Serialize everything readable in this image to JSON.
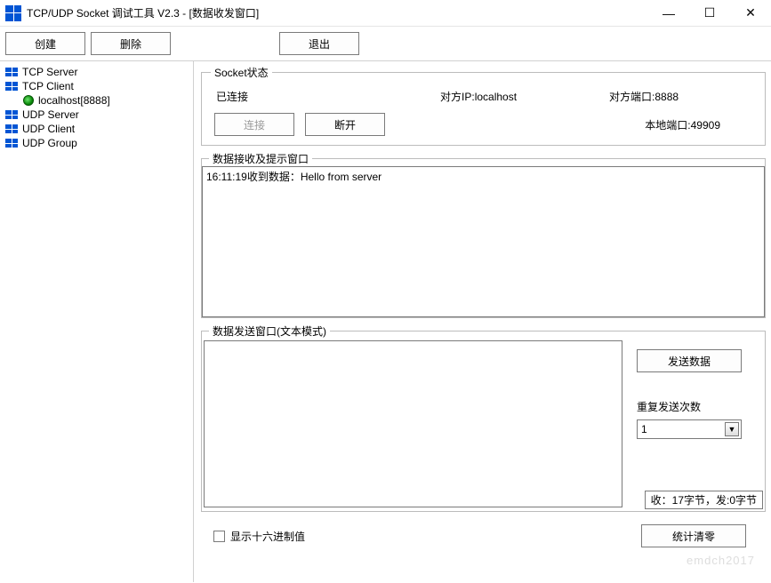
{
  "title": "TCP/UDP Socket 调试工具 V2.3 - [数据收发窗口]",
  "toolbar": {
    "create": "创建",
    "delete": "删除",
    "exit": "退出"
  },
  "tree": {
    "items": [
      {
        "label": "TCP Server",
        "type": "node"
      },
      {
        "label": "TCP Client",
        "type": "node"
      },
      {
        "label": "localhost[8888]",
        "type": "conn"
      },
      {
        "label": "UDP Server",
        "type": "node"
      },
      {
        "label": "UDP Client",
        "type": "node"
      },
      {
        "label": "UDP Group",
        "type": "node"
      }
    ]
  },
  "status": {
    "legend": "Socket状态",
    "state": "已连接",
    "peer_ip_label": "对方IP:",
    "peer_ip": "localhost",
    "peer_port_label": "对方端口:",
    "peer_port": "8888",
    "connect": "连接",
    "disconnect": "断开",
    "local_port_label": "本地端口:",
    "local_port": "49909"
  },
  "rx": {
    "legend": "数据接收及提示窗口",
    "line": "16:11:19收到数据：Hello from server"
  },
  "tx": {
    "legend": "数据发送窗口(文本模式)",
    "send": "发送数据",
    "repeat_label": "重复发送次数",
    "repeat_value": "1",
    "stats": "收：17字节，发:0字节"
  },
  "bottom": {
    "hex_label": "显示十六进制值",
    "clear": "统计清零"
  },
  "watermark": "emdch2017"
}
